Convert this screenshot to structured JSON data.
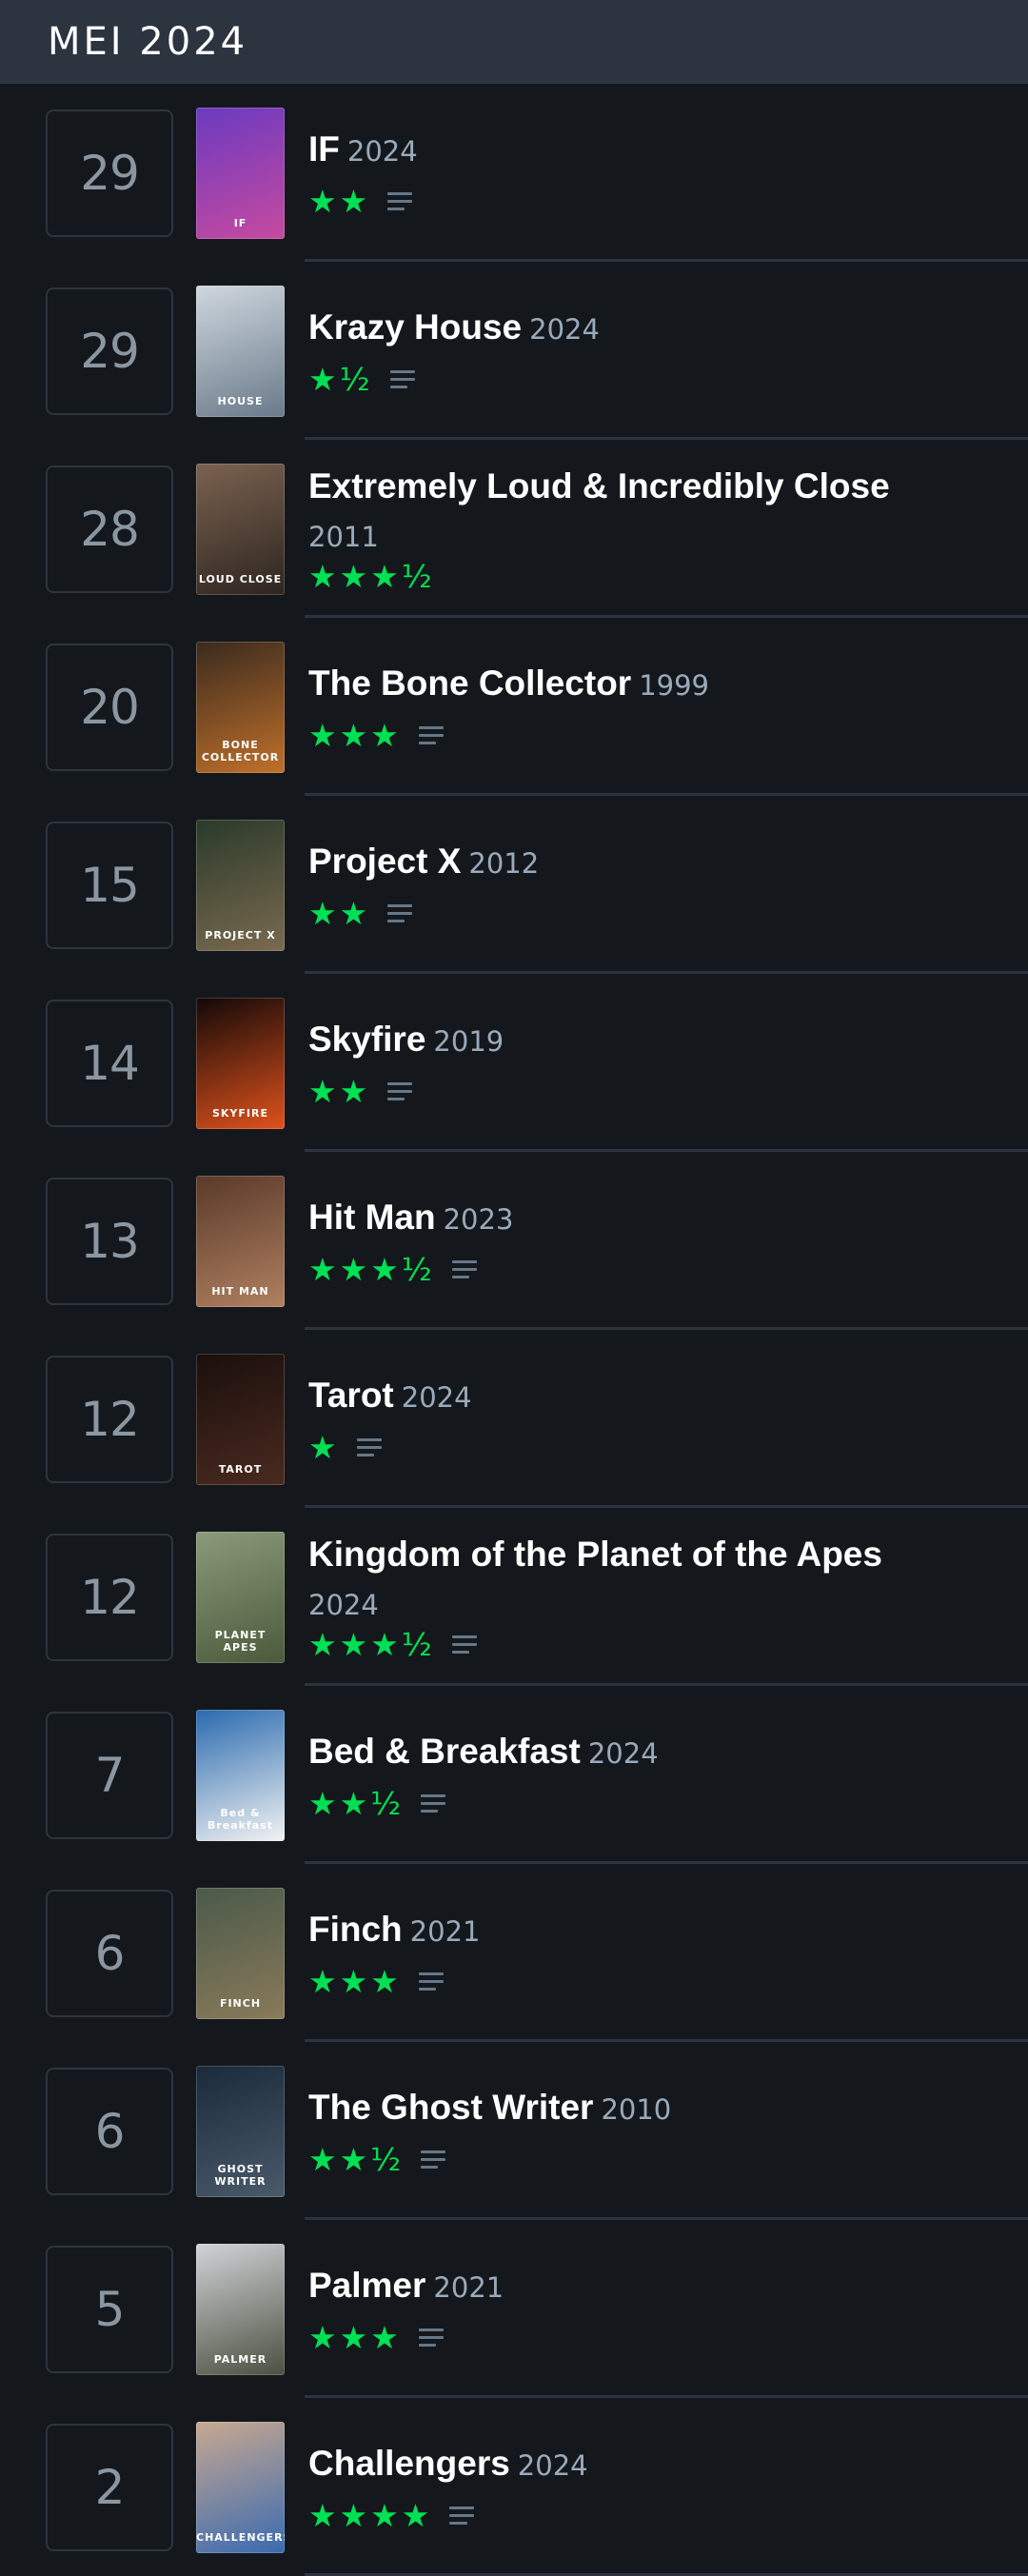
{
  "header": {
    "month": "MEI 2024"
  },
  "entries": [
    {
      "day": "29",
      "title": "IF",
      "year": "2024",
      "stars": "★★",
      "review": true,
      "poster_colors": [
        "#6b3ac0",
        "#c64aa0"
      ],
      "poster_text": "IF"
    },
    {
      "day": "29",
      "title": "Krazy House",
      "year": "2024",
      "stars": "★½",
      "review": true,
      "poster_colors": [
        "#cfd7de",
        "#6a7a8a"
      ],
      "poster_text": "HOUSE"
    },
    {
      "day": "28",
      "title": "Extremely Loud & Incredibly Close",
      "year": "2011",
      "stars": "★★★½",
      "review": false,
      "wrap": true,
      "poster_colors": [
        "#7a6250",
        "#2e2520"
      ],
      "poster_text": "LOUD CLOSE"
    },
    {
      "day": "20",
      "title": "The Bone Collector",
      "year": "1999",
      "stars": "★★★",
      "review": true,
      "poster_colors": [
        "#3a2a1e",
        "#c0702a"
      ],
      "poster_text": "BONE COLLECTOR"
    },
    {
      "day": "15",
      "title": "Project X",
      "year": "2012",
      "stars": "★★",
      "review": true,
      "poster_colors": [
        "#2a3a2a",
        "#7a6a50"
      ],
      "poster_text": "PROJECT X"
    },
    {
      "day": "14",
      "title": "Skyfire",
      "year": "2019",
      "stars": "★★",
      "review": true,
      "poster_colors": [
        "#120808",
        "#e0521c"
      ],
      "poster_text": "SKYFIRE"
    },
    {
      "day": "13",
      "title": "Hit Man",
      "year": "2023",
      "stars": "★★★½",
      "review": true,
      "poster_colors": [
        "#5a3a2a",
        "#b08060"
      ],
      "poster_text": "HIT MAN"
    },
    {
      "day": "12",
      "title": "Tarot",
      "year": "2024",
      "stars": "★",
      "review": true,
      "poster_colors": [
        "#1a0f0c",
        "#4a2a20"
      ],
      "poster_text": "TAROT"
    },
    {
      "day": "12",
      "title": "Kingdom of the Planet of the Apes",
      "year": "2024",
      "stars": "★★★½",
      "review": true,
      "wrap": true,
      "poster_colors": [
        "#8a9a7a",
        "#4a5a3a"
      ],
      "poster_text": "PLANET APES"
    },
    {
      "day": "7",
      "title": "Bed & Breakfast",
      "year": "2024",
      "stars": "★★½",
      "review": true,
      "poster_colors": [
        "#2a6ab0",
        "#f2f2f2"
      ],
      "poster_text": "Bed & Breakfast"
    },
    {
      "day": "6",
      "title": "Finch",
      "year": "2021",
      "stars": "★★★",
      "review": true,
      "poster_colors": [
        "#4a5a4a",
        "#8a7a5a"
      ],
      "poster_text": "FINCH"
    },
    {
      "day": "6",
      "title": "The Ghost Writer",
      "year": "2010",
      "stars": "★★½",
      "review": true,
      "poster_colors": [
        "#1a2a3a",
        "#4a5a6a"
      ],
      "poster_text": "GHOST WRITER"
    },
    {
      "day": "5",
      "title": "Palmer",
      "year": "2021",
      "stars": "★★★",
      "review": true,
      "poster_colors": [
        "#d0d4d8",
        "#4a5040"
      ],
      "poster_text": "PALMER"
    },
    {
      "day": "2",
      "title": "Challengers",
      "year": "2024",
      "stars": "★★★★",
      "review": true,
      "poster_colors": [
        "#c8a890",
        "#3a6ab0"
      ],
      "poster_text": "CHALLENGERS"
    }
  ]
}
